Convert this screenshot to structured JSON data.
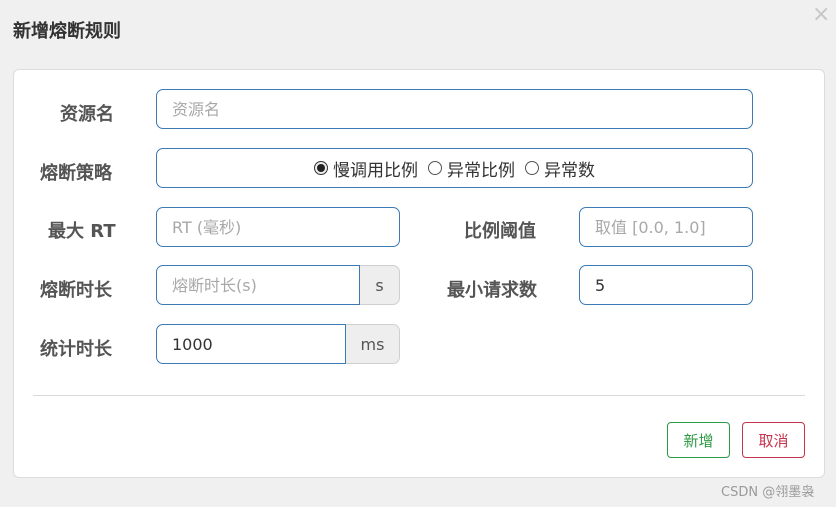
{
  "dialog": {
    "title": "新增熔断规则",
    "close_glyph": "×"
  },
  "form": {
    "resource": {
      "label": "资源名",
      "placeholder": "资源名",
      "value": ""
    },
    "strategy": {
      "label": "熔断策略",
      "options": [
        {
          "label": "慢调用比例",
          "checked": true
        },
        {
          "label": "异常比例",
          "checked": false
        },
        {
          "label": "异常数",
          "checked": false
        }
      ]
    },
    "max_rt": {
      "label": "最大 RT",
      "placeholder": "RT (毫秒)",
      "value": ""
    },
    "ratio_threshold": {
      "label": "比例阈值",
      "placeholder": "取值 [0.0, 1.0]",
      "value": ""
    },
    "break_duration": {
      "label": "熔断时长",
      "placeholder": "熔断时长(s)",
      "value": "",
      "unit": "s"
    },
    "min_requests": {
      "label": "最小请求数",
      "placeholder": "",
      "value": "5"
    },
    "stat_duration": {
      "label": "统计时长",
      "placeholder": "",
      "value": "1000",
      "unit": "ms"
    }
  },
  "buttons": {
    "add_label": "新增",
    "cancel_label": "取消",
    "add_color": "#2f9a46",
    "cancel_color": "#c6344c"
  },
  "watermark": "CSDN @翎墨袅"
}
